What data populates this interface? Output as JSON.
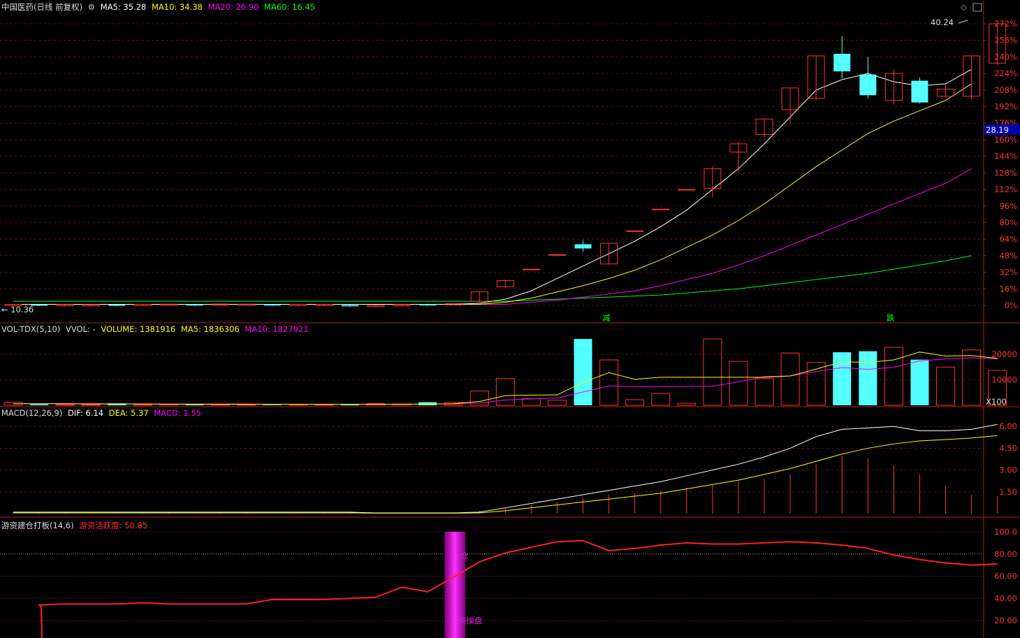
{
  "colors": {
    "up": "#ff3232",
    "down": "#54ffff",
    "grid": "#7a1010",
    "ma5": "#ffffff",
    "ma10": "#ffff00",
    "ma20": "#ff00ff",
    "ma60": "#00ff00",
    "frame": "#8b1a1a",
    "osc": "#ff2020",
    "purple": "#c010c0"
  },
  "price_panel": {
    "title": "中国医药(日线 前复权)",
    "ma5": "MA5: 35.28",
    "ma10": "MA10: 34.38",
    "ma20": "MA20: 26.90",
    "ma60": "MA60: 16.45",
    "high_label": "40.24",
    "low_label": "← 10.36",
    "price_tag": "28.19",
    "y_ticks": [
      "272%",
      "256%",
      "240%",
      "224%",
      "208%",
      "192%",
      "176%",
      "160%",
      "144%",
      "128%",
      "112%",
      "96%",
      "80%",
      "64%",
      "48%",
      "32%",
      "16%",
      "0%"
    ],
    "markers": [
      {
        "text": "减",
        "bar": 23
      },
      {
        "text": "跌",
        "bar": 34
      }
    ]
  },
  "vol_panel": {
    "title": "VOL-TDX(5,10)",
    "vvol": "VVOL: -",
    "volume": "VOLUME: 1381916",
    "ma5": "MA5: 1836306",
    "ma10": "MA10: 1827921",
    "y_ticks": [
      "20000",
      "10000"
    ],
    "unit": "X100"
  },
  "macd_panel": {
    "title": "MACD(12,26,9)",
    "dif": "DIF: 6.14",
    "dea": "DEA: 5.37",
    "macd": "MACD: 1.55",
    "y_ticks": [
      "6.00",
      "4.50",
      "3.00",
      "1.50"
    ]
  },
  "osc_panel": {
    "title": "游资建仓打板(14,6)",
    "value": "游资活跃度: 50.85",
    "y_ticks": [
      "100.0",
      "80.00",
      "60.00",
      "40.00",
      "20.00"
    ],
    "labels": [
      "仓",
      "资操盘"
    ]
  },
  "chart_data": [
    {
      "type": "candlestick",
      "title": "中国医药(日线 前复权)",
      "ylabel": "%",
      "ylim": [
        0,
        280
      ],
      "candles": [
        {
          "o": 4,
          "c": 28,
          "h": 28,
          "l": 2,
          "dir": "up"
        },
        {
          "o": 32,
          "c": 52,
          "h": 54,
          "l": 32,
          "dir": "up"
        },
        {
          "o": 99,
          "c": 99,
          "h": 99,
          "l": 99,
          "dir": "up"
        },
        {
          "o": 123,
          "c": 123,
          "h": 123,
          "l": 123,
          "dir": "up"
        },
        {
          "o": 145,
          "c": 145,
          "h": 145,
          "l": 145,
          "dir": "up"
        },
        {
          "o": 169,
          "c": 169,
          "h": 169,
          "l": 169,
          "dir": "up"
        },
        {
          "o": 177,
          "c": 171,
          "h": 185,
          "l": 162,
          "dir": "down"
        },
        {
          "o": 155,
          "c": 173,
          "h": 173,
          "l": 154,
          "dir": "up"
        },
        {
          "o": 199,
          "c": 199,
          "h": 199,
          "l": 199,
          "dir": "up"
        },
        {
          "o": 224,
          "c": 224,
          "h": 224,
          "l": 224,
          "dir": "up"
        },
        {
          "o": 251,
          "c": 251,
          "h": 251,
          "l": 251,
          "dir": "up"
        },
        {
          "o": 272,
          "c": 272,
          "h": 272,
          "l": 272,
          "dir": "up"
        }
      ]
    }
  ]
}
